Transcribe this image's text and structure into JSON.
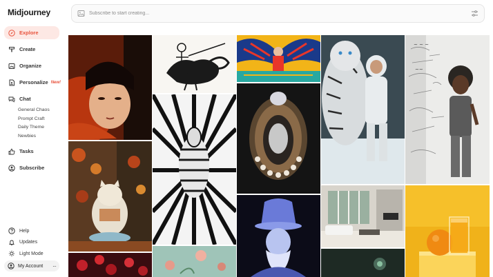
{
  "app": {
    "title": "Midjourney"
  },
  "search": {
    "placeholder": "Subscribe to start creating..."
  },
  "nav": {
    "explore": "Explore",
    "create": "Create",
    "organize": "Organize",
    "personalize": "Personalize",
    "personalize_badge": "New!",
    "chat": "Chat",
    "chat_rooms": [
      "General Chaos",
      "Prompt Craft",
      "Daily Theme",
      "Newbies"
    ],
    "tasks": "Tasks",
    "subscribe": "Subscribe"
  },
  "bottom_nav": {
    "help": "Help",
    "updates": "Updates",
    "light_mode": "Light Mode",
    "account": "My Account",
    "account_menu": "···"
  },
  "colors": {
    "accent": "#e8533d",
    "active_bg": "#fde8e4"
  },
  "gallery": {
    "images": [
      "girl-portrait-red-scarf",
      "skeleton-riding-rooster",
      "zebra-optical-stripes",
      "cat-reading-book-autumn",
      "floral-teal-tile",
      "red-berries",
      "folk-art-winged-figure",
      "jeweled-ornament",
      "glowing-wizard-bust",
      "tiger-and-astronaut",
      "modern-living-room",
      "dark-scene",
      "boy-by-graffiti-wall",
      "orange-and-juice"
    ]
  }
}
